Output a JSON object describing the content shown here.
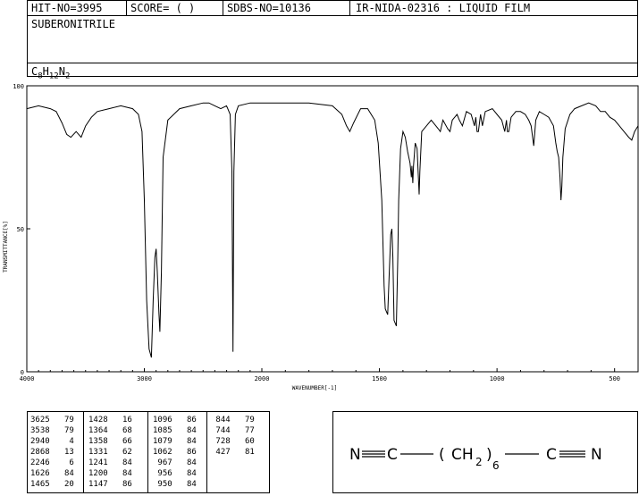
{
  "header": {
    "hit_no": "HIT-NO=3995",
    "score": "SCORE=  (   )",
    "sdbs_no": "SDBS-NO=10136",
    "ir_code": "IR-NIDA-02316 : LIQUID FILM",
    "compound": "SUBERONITRILE",
    "formula": {
      "c": "C",
      "c_n": "8",
      "h": "H",
      "h_n": "12",
      "n": "N",
      "n_n": "2"
    }
  },
  "chart_data": {
    "type": "line",
    "xlabel": "WAVENUMBER[-1]",
    "ylabel": "TRANSMITTANCE[%]",
    "x_ticks": [
      "4000",
      "3000",
      "2000",
      "1500",
      "1000",
      "500"
    ],
    "y_ticks": [
      "100",
      "50",
      "0"
    ],
    "xlim": [
      4000,
      400
    ],
    "ylim": [
      0,
      100
    ],
    "x_scale": "piecewise-linear (4000-2000, 2000-400)",
    "series": [
      {
        "points": [
          [
            4000,
            92
          ],
          [
            3900,
            93
          ],
          [
            3800,
            92
          ],
          [
            3750,
            91
          ],
          [
            3700,
            87
          ],
          [
            3660,
            83
          ],
          [
            3625,
            82
          ],
          [
            3580,
            84
          ],
          [
            3538,
            82
          ],
          [
            3500,
            86
          ],
          [
            3450,
            89
          ],
          [
            3400,
            91
          ],
          [
            3300,
            92
          ],
          [
            3200,
            93
          ],
          [
            3100,
            92
          ],
          [
            3050,
            90
          ],
          [
            3020,
            84
          ],
          [
            3000,
            60
          ],
          [
            2980,
            25
          ],
          [
            2960,
            8
          ],
          [
            2940,
            5
          ],
          [
            2925,
            25
          ],
          [
            2910,
            40
          ],
          [
            2900,
            43
          ],
          [
            2890,
            35
          ],
          [
            2875,
            20
          ],
          [
            2868,
            14
          ],
          [
            2855,
            35
          ],
          [
            2840,
            75
          ],
          [
            2800,
            88
          ],
          [
            2700,
            92
          ],
          [
            2600,
            93
          ],
          [
            2500,
            94
          ],
          [
            2450,
            94
          ],
          [
            2400,
            93
          ],
          [
            2350,
            92
          ],
          [
            2300,
            93
          ],
          [
            2270,
            90
          ],
          [
            2255,
            70
          ],
          [
            2246,
            7
          ],
          [
            2238,
            70
          ],
          [
            2225,
            90
          ],
          [
            2200,
            93
          ],
          [
            2100,
            94
          ],
          [
            2000,
            94
          ],
          [
            1900,
            94
          ],
          [
            1800,
            94
          ],
          [
            1700,
            93
          ],
          [
            1660,
            90
          ],
          [
            1640,
            86
          ],
          [
            1626,
            84
          ],
          [
            1610,
            87
          ],
          [
            1580,
            92
          ],
          [
            1550,
            92
          ],
          [
            1520,
            88
          ],
          [
            1505,
            80
          ],
          [
            1490,
            60
          ],
          [
            1480,
            30
          ],
          [
            1475,
            22
          ],
          [
            1465,
            20
          ],
          [
            1458,
            35
          ],
          [
            1452,
            48
          ],
          [
            1447,
            50
          ],
          [
            1443,
            40
          ],
          [
            1438,
            18
          ],
          [
            1428,
            16
          ],
          [
            1422,
            40
          ],
          [
            1418,
            60
          ],
          [
            1410,
            78
          ],
          [
            1400,
            84
          ],
          [
            1390,
            82
          ],
          [
            1380,
            77
          ],
          [
            1370,
            73
          ],
          [
            1364,
            68
          ],
          [
            1362,
            72
          ],
          [
            1358,
            66
          ],
          [
            1355,
            72
          ],
          [
            1348,
            80
          ],
          [
            1340,
            78
          ],
          [
            1331,
            62
          ],
          [
            1328,
            70
          ],
          [
            1320,
            84
          ],
          [
            1300,
            86
          ],
          [
            1280,
            88
          ],
          [
            1260,
            86
          ],
          [
            1250,
            85
          ],
          [
            1241,
            84
          ],
          [
            1230,
            88
          ],
          [
            1210,
            85
          ],
          [
            1200,
            84
          ],
          [
            1190,
            88
          ],
          [
            1170,
            90
          ],
          [
            1160,
            88
          ],
          [
            1147,
            86
          ],
          [
            1130,
            91
          ],
          [
            1110,
            90
          ],
          [
            1096,
            86
          ],
          [
            1090,
            89
          ],
          [
            1085,
            84
          ],
          [
            1079,
            84
          ],
          [
            1070,
            90
          ],
          [
            1062,
            86
          ],
          [
            1050,
            91
          ],
          [
            1020,
            92
          ],
          [
            1000,
            90
          ],
          [
            980,
            88
          ],
          [
            967,
            84
          ],
          [
            960,
            88
          ],
          [
            956,
            84
          ],
          [
            950,
            84
          ],
          [
            940,
            89
          ],
          [
            920,
            91
          ],
          [
            900,
            91
          ],
          [
            880,
            90
          ],
          [
            865,
            88
          ],
          [
            855,
            86
          ],
          [
            844,
            79
          ],
          [
            835,
            88
          ],
          [
            820,
            91
          ],
          [
            800,
            90
          ],
          [
            780,
            89
          ],
          [
            760,
            86
          ],
          [
            750,
            80
          ],
          [
            744,
            77
          ],
          [
            738,
            75
          ],
          [
            732,
            68
          ],
          [
            728,
            60
          ],
          [
            724,
            65
          ],
          [
            720,
            75
          ],
          [
            710,
            85
          ],
          [
            690,
            90
          ],
          [
            670,
            92
          ],
          [
            640,
            93
          ],
          [
            610,
            94
          ],
          [
            580,
            93
          ],
          [
            560,
            91
          ],
          [
            540,
            91
          ],
          [
            520,
            89
          ],
          [
            500,
            88
          ],
          [
            480,
            86
          ],
          [
            460,
            84
          ],
          [
            440,
            82
          ],
          [
            427,
            81
          ],
          [
            415,
            84
          ],
          [
            400,
            86
          ]
        ]
      }
    ]
  },
  "peak_table": [
    [
      "3625",
      "79"
    ],
    [
      "3538",
      "79"
    ],
    [
      "2940",
      "4"
    ],
    [
      "2868",
      "13"
    ],
    [
      "2246",
      "6"
    ],
    [
      "1626",
      "84"
    ],
    [
      "1465",
      "20"
    ],
    [
      "1428",
      "16"
    ],
    [
      "1364",
      "68"
    ],
    [
      "1358",
      "66"
    ],
    [
      "1331",
      "62"
    ],
    [
      "1241",
      "84"
    ],
    [
      "1200",
      "84"
    ],
    [
      "1147",
      "86"
    ],
    [
      "1096",
      "86"
    ],
    [
      "1085",
      "84"
    ],
    [
      "1079",
      "84"
    ],
    [
      "1062",
      "86"
    ],
    [
      "967",
      "84"
    ],
    [
      "956",
      "84"
    ],
    [
      "950",
      "84"
    ],
    [
      "844",
      "79"
    ],
    [
      "744",
      "77"
    ],
    [
      "728",
      "60"
    ],
    [
      "427",
      "81"
    ]
  ],
  "structure": {
    "n_left": "N",
    "c_left": "C",
    "paren_open": "(",
    "ch": "CH",
    "ch_sub": "2",
    "paren_close": ")",
    "n_count": "6",
    "c_right": "C",
    "n_right": "N"
  }
}
